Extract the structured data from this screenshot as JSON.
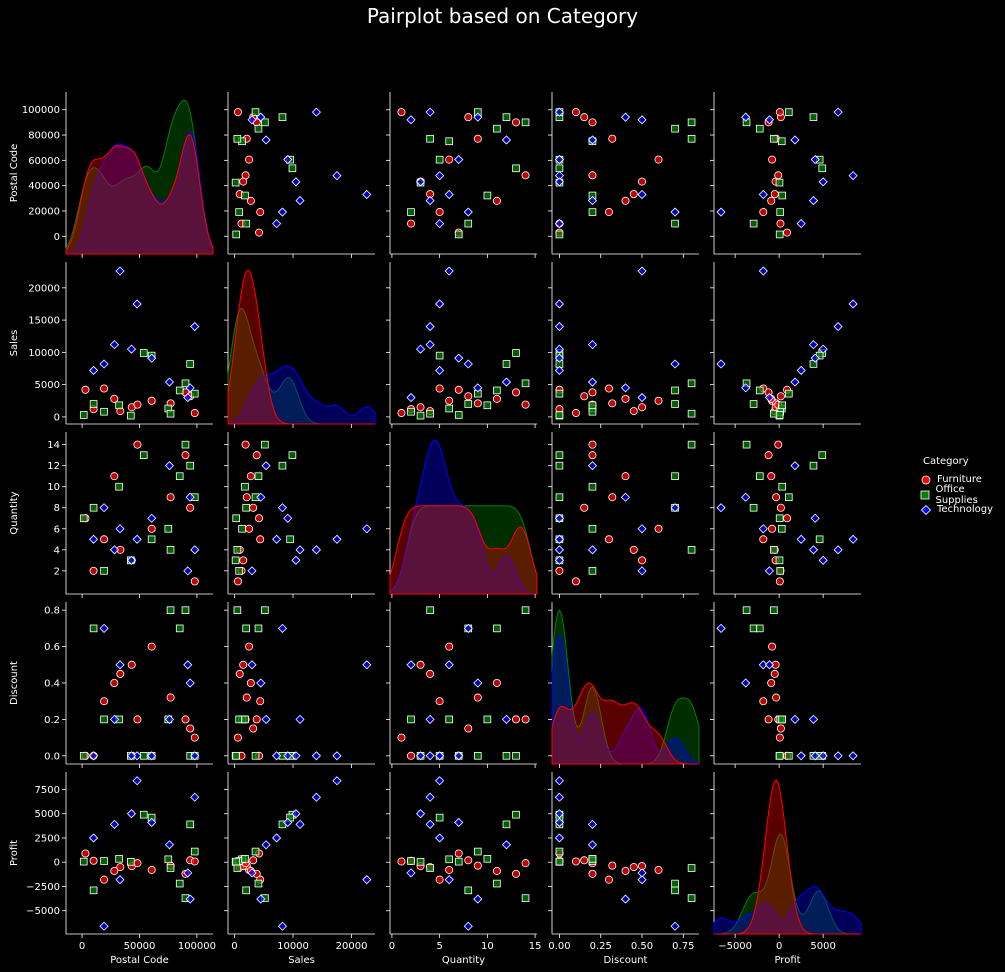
{
  "title": "Pairplot based on Category",
  "legend": {
    "title": "Category",
    "items": [
      {
        "label": "Furniture",
        "color": "#ff0000",
        "marker": "circle"
      },
      {
        "label": "Office Supplies",
        "color": "#008000",
        "marker": "square"
      },
      {
        "label": "Technology",
        "color": "#0000ff",
        "marker": "diamond"
      }
    ]
  },
  "chart_data": {
    "type": "scatter",
    "variables": [
      "Postal Code",
      "Sales",
      "Quantity",
      "Discount",
      "Profit"
    ],
    "axes": {
      "Postal Code": {
        "range": [
          -14000,
          114000
        ],
        "ticks": [
          0,
          20000,
          40000,
          60000,
          80000,
          100000
        ],
        "tick_labels_y": [
          "0",
          "20000",
          "40000",
          "60000",
          "80000",
          "100000"
        ],
        "ticks_x": [
          0,
          50000,
          100000
        ],
        "tick_labels_x": [
          "0",
          "50000",
          "100000"
        ]
      },
      "Sales": {
        "range": [
          -1100,
          24000
        ],
        "ticks": [
          0,
          5000,
          10000,
          15000,
          20000
        ],
        "tick_labels_y": [
          "0",
          "5000",
          "10000",
          "15000",
          "20000"
        ],
        "ticks_x": [
          0,
          10000,
          20000
        ],
        "tick_labels_x": [
          "0",
          "10000",
          "20000"
        ]
      },
      "Quantity": {
        "range": [
          -0.2,
          15.2
        ],
        "ticks": [
          2,
          4,
          6,
          8,
          10,
          12,
          14
        ],
        "tick_labels_y": [
          "2",
          "4",
          "6",
          "8",
          "10",
          "12",
          "14"
        ],
        "ticks_x": [
          0,
          5,
          10,
          15
        ],
        "tick_labels_x": [
          "0",
          "5",
          "10",
          "15"
        ]
      },
      "Discount": {
        "range": [
          -0.045,
          0.845
        ],
        "ticks": [
          0.0,
          0.2,
          0.4,
          0.6,
          0.8
        ],
        "tick_labels_y": [
          "0.0",
          "0.2",
          "0.4",
          "0.6",
          "0.8"
        ],
        "ticks_x": [
          0.0,
          0.25,
          0.5,
          0.75
        ],
        "tick_labels_x": [
          "0.00",
          "0.25",
          "0.50",
          "0.75"
        ]
      },
      "Profit": {
        "range": [
          -7400,
          9300
        ],
        "ticks": [
          -5000,
          -2500,
          0,
          2500,
          5000,
          7500
        ],
        "tick_labels_y": [
          "−5000",
          "−2500",
          "0",
          "2500",
          "5000",
          "7500"
        ],
        "ticks_x": [
          -5000,
          0,
          5000
        ],
        "tick_labels_x": [
          "−5000",
          "0",
          "5000"
        ]
      }
    },
    "hue": "Category",
    "series": [
      {
        "name": "Furniture",
        "color": "#ff0000",
        "marker": "circle",
        "points": [
          {
            "Postal Code": 10024,
            "Sales": 1200,
            "Quantity": 2,
            "Discount": 0.0,
            "Profit": 150
          },
          {
            "Postal Code": 19143,
            "Sales": 4400,
            "Quantity": 5,
            "Discount": 0.3,
            "Profit": -1800
          },
          {
            "Postal Code": 90049,
            "Sales": 3800,
            "Quantity": 13,
            "Discount": 0.2,
            "Profit": -1200
          },
          {
            "Postal Code": 60610,
            "Sales": 2500,
            "Quantity": 6,
            "Discount": 0.6,
            "Profit": -800
          },
          {
            "Postal Code": 77095,
            "Sales": 2100,
            "Quantity": 9,
            "Discount": 0.32,
            "Profit": -350
          },
          {
            "Postal Code": 33311,
            "Sales": 900,
            "Quantity": 4,
            "Discount": 0.45,
            "Profit": -500
          },
          {
            "Postal Code": 94110,
            "Sales": 3200,
            "Quantity": 8,
            "Discount": 0.15,
            "Profit": 200
          },
          {
            "Postal Code": 43229,
            "Sales": 1500,
            "Quantity": 3,
            "Discount": 0.5,
            "Profit": -400
          },
          {
            "Postal Code": 28027,
            "Sales": 2800,
            "Quantity": 11,
            "Discount": 0.4,
            "Profit": -900
          },
          {
            "Postal Code": 98105,
            "Sales": 600,
            "Quantity": 1,
            "Discount": 0.1,
            "Profit": 80
          },
          {
            "Postal Code": 2920,
            "Sales": 4200,
            "Quantity": 7,
            "Discount": 0.0,
            "Profit": 900
          },
          {
            "Postal Code": 48205,
            "Sales": 1900,
            "Quantity": 14,
            "Discount": 0.2,
            "Profit": -100
          }
        ]
      },
      {
        "name": "Office Supplies",
        "color": "#008000",
        "marker": "square",
        "points": [
          {
            "Postal Code": 42420,
            "Sales": 200,
            "Quantity": 3,
            "Discount": 0.0,
            "Profit": 40
          },
          {
            "Postal Code": 53711,
            "Sales": 9900,
            "Quantity": 13,
            "Discount": 0.0,
            "Profit": 4900
          },
          {
            "Postal Code": 60540,
            "Sales": 9500,
            "Quantity": 5,
            "Discount": 0.0,
            "Profit": 4600
          },
          {
            "Postal Code": 90036,
            "Sales": 5200,
            "Quantity": 14,
            "Discount": 0.8,
            "Profit": -3700
          },
          {
            "Postal Code": 10035,
            "Sales": 2000,
            "Quantity": 8,
            "Discount": 0.7,
            "Profit": -2900
          },
          {
            "Postal Code": 75080,
            "Sales": 1300,
            "Quantity": 6,
            "Discount": 0.2,
            "Profit": 300
          },
          {
            "Postal Code": 19120,
            "Sales": 800,
            "Quantity": 2,
            "Discount": 0.2,
            "Profit": 120
          },
          {
            "Postal Code": 94122,
            "Sales": 8200,
            "Quantity": 12,
            "Discount": 0.0,
            "Profit": 3900
          },
          {
            "Postal Code": 98103,
            "Sales": 3600,
            "Quantity": 9,
            "Discount": 0.0,
            "Profit": 1100
          },
          {
            "Postal Code": 77041,
            "Sales": 500,
            "Quantity": 4,
            "Discount": 0.8,
            "Profit": -600
          },
          {
            "Postal Code": 32216,
            "Sales": 1800,
            "Quantity": 10,
            "Discount": 0.2,
            "Profit": 350
          },
          {
            "Postal Code": 1453,
            "Sales": 300,
            "Quantity": 7,
            "Discount": 0.0,
            "Profit": 60
          },
          {
            "Postal Code": 85023,
            "Sales": 4100,
            "Quantity": 11,
            "Discount": 0.7,
            "Profit": -2200
          }
        ]
      },
      {
        "name": "Technology",
        "color": "#0000ff",
        "marker": "diamond",
        "points": [
          {
            "Postal Code": 47905,
            "Sales": 17500,
            "Quantity": 5,
            "Discount": 0.0,
            "Profit": 8400
          },
          {
            "Postal Code": 98115,
            "Sales": 14000,
            "Quantity": 4,
            "Discount": 0.0,
            "Profit": 6700
          },
          {
            "Postal Code": 33012,
            "Sales": 22600,
            "Quantity": 6,
            "Discount": 0.5,
            "Profit": -1800
          },
          {
            "Postal Code": 19140,
            "Sales": 8200,
            "Quantity": 8,
            "Discount": 0.7,
            "Profit": -6600
          },
          {
            "Postal Code": 43017,
            "Sales": 10500,
            "Quantity": 3,
            "Discount": 0.0,
            "Profit": 5000
          },
          {
            "Postal Code": 28205,
            "Sales": 11200,
            "Quantity": 4,
            "Discount": 0.2,
            "Profit": 3900
          },
          {
            "Postal Code": 94109,
            "Sales": 4500,
            "Quantity": 9,
            "Discount": 0.4,
            "Profit": -3800
          },
          {
            "Postal Code": 10009,
            "Sales": 7200,
            "Quantity": 5,
            "Discount": 0.0,
            "Profit": 2500
          },
          {
            "Postal Code": 76106,
            "Sales": 5400,
            "Quantity": 12,
            "Discount": 0.2,
            "Profit": 1800
          },
          {
            "Postal Code": 60623,
            "Sales": 9100,
            "Quantity": 7,
            "Discount": 0.0,
            "Profit": 4100
          },
          {
            "Postal Code": 92037,
            "Sales": 3000,
            "Quantity": 2,
            "Discount": 0.5,
            "Profit": -1100
          }
        ]
      }
    ]
  }
}
